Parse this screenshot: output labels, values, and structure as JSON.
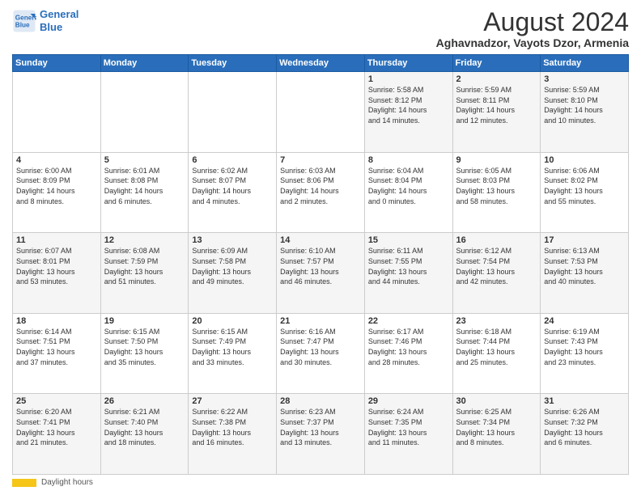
{
  "logo": {
    "line1": "General",
    "line2": "Blue"
  },
  "title": "August 2024",
  "subtitle": "Aghavnadzor, Vayots Dzor, Armenia",
  "days_of_week": [
    "Sunday",
    "Monday",
    "Tuesday",
    "Wednesday",
    "Thursday",
    "Friday",
    "Saturday"
  ],
  "footer": {
    "label": "Daylight hours"
  },
  "weeks": [
    [
      {
        "day": "",
        "info": ""
      },
      {
        "day": "",
        "info": ""
      },
      {
        "day": "",
        "info": ""
      },
      {
        "day": "",
        "info": ""
      },
      {
        "day": "1",
        "info": "Sunrise: 5:58 AM\nSunset: 8:12 PM\nDaylight: 14 hours\nand 14 minutes."
      },
      {
        "day": "2",
        "info": "Sunrise: 5:59 AM\nSunset: 8:11 PM\nDaylight: 14 hours\nand 12 minutes."
      },
      {
        "day": "3",
        "info": "Sunrise: 5:59 AM\nSunset: 8:10 PM\nDaylight: 14 hours\nand 10 minutes."
      }
    ],
    [
      {
        "day": "4",
        "info": "Sunrise: 6:00 AM\nSunset: 8:09 PM\nDaylight: 14 hours\nand 8 minutes."
      },
      {
        "day": "5",
        "info": "Sunrise: 6:01 AM\nSunset: 8:08 PM\nDaylight: 14 hours\nand 6 minutes."
      },
      {
        "day": "6",
        "info": "Sunrise: 6:02 AM\nSunset: 8:07 PM\nDaylight: 14 hours\nand 4 minutes."
      },
      {
        "day": "7",
        "info": "Sunrise: 6:03 AM\nSunset: 8:06 PM\nDaylight: 14 hours\nand 2 minutes."
      },
      {
        "day": "8",
        "info": "Sunrise: 6:04 AM\nSunset: 8:04 PM\nDaylight: 14 hours\nand 0 minutes."
      },
      {
        "day": "9",
        "info": "Sunrise: 6:05 AM\nSunset: 8:03 PM\nDaylight: 13 hours\nand 58 minutes."
      },
      {
        "day": "10",
        "info": "Sunrise: 6:06 AM\nSunset: 8:02 PM\nDaylight: 13 hours\nand 55 minutes."
      }
    ],
    [
      {
        "day": "11",
        "info": "Sunrise: 6:07 AM\nSunset: 8:01 PM\nDaylight: 13 hours\nand 53 minutes."
      },
      {
        "day": "12",
        "info": "Sunrise: 6:08 AM\nSunset: 7:59 PM\nDaylight: 13 hours\nand 51 minutes."
      },
      {
        "day": "13",
        "info": "Sunrise: 6:09 AM\nSunset: 7:58 PM\nDaylight: 13 hours\nand 49 minutes."
      },
      {
        "day": "14",
        "info": "Sunrise: 6:10 AM\nSunset: 7:57 PM\nDaylight: 13 hours\nand 46 minutes."
      },
      {
        "day": "15",
        "info": "Sunrise: 6:11 AM\nSunset: 7:55 PM\nDaylight: 13 hours\nand 44 minutes."
      },
      {
        "day": "16",
        "info": "Sunrise: 6:12 AM\nSunset: 7:54 PM\nDaylight: 13 hours\nand 42 minutes."
      },
      {
        "day": "17",
        "info": "Sunrise: 6:13 AM\nSunset: 7:53 PM\nDaylight: 13 hours\nand 40 minutes."
      }
    ],
    [
      {
        "day": "18",
        "info": "Sunrise: 6:14 AM\nSunset: 7:51 PM\nDaylight: 13 hours\nand 37 minutes."
      },
      {
        "day": "19",
        "info": "Sunrise: 6:15 AM\nSunset: 7:50 PM\nDaylight: 13 hours\nand 35 minutes."
      },
      {
        "day": "20",
        "info": "Sunrise: 6:15 AM\nSunset: 7:49 PM\nDaylight: 13 hours\nand 33 minutes."
      },
      {
        "day": "21",
        "info": "Sunrise: 6:16 AM\nSunset: 7:47 PM\nDaylight: 13 hours\nand 30 minutes."
      },
      {
        "day": "22",
        "info": "Sunrise: 6:17 AM\nSunset: 7:46 PM\nDaylight: 13 hours\nand 28 minutes."
      },
      {
        "day": "23",
        "info": "Sunrise: 6:18 AM\nSunset: 7:44 PM\nDaylight: 13 hours\nand 25 minutes."
      },
      {
        "day": "24",
        "info": "Sunrise: 6:19 AM\nSunset: 7:43 PM\nDaylight: 13 hours\nand 23 minutes."
      }
    ],
    [
      {
        "day": "25",
        "info": "Sunrise: 6:20 AM\nSunset: 7:41 PM\nDaylight: 13 hours\nand 21 minutes."
      },
      {
        "day": "26",
        "info": "Sunrise: 6:21 AM\nSunset: 7:40 PM\nDaylight: 13 hours\nand 18 minutes."
      },
      {
        "day": "27",
        "info": "Sunrise: 6:22 AM\nSunset: 7:38 PM\nDaylight: 13 hours\nand 16 minutes."
      },
      {
        "day": "28",
        "info": "Sunrise: 6:23 AM\nSunset: 7:37 PM\nDaylight: 13 hours\nand 13 minutes."
      },
      {
        "day": "29",
        "info": "Sunrise: 6:24 AM\nSunset: 7:35 PM\nDaylight: 13 hours\nand 11 minutes."
      },
      {
        "day": "30",
        "info": "Sunrise: 6:25 AM\nSunset: 7:34 PM\nDaylight: 13 hours\nand 8 minutes."
      },
      {
        "day": "31",
        "info": "Sunrise: 6:26 AM\nSunset: 7:32 PM\nDaylight: 13 hours\nand 6 minutes."
      }
    ]
  ]
}
